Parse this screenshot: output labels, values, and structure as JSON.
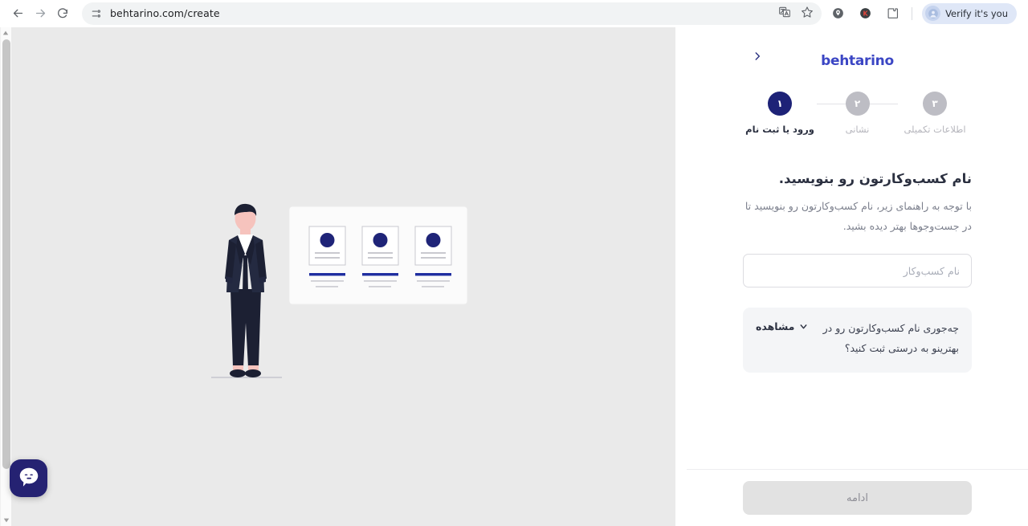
{
  "browser": {
    "back_icon": "arrow-left-icon",
    "forward_icon": "arrow-right-icon",
    "reload_icon": "reload-icon",
    "site_info_icon": "page-info-icon",
    "url": "behtarino.com/create",
    "translate_icon": "translate-icon",
    "bookmark_icon": "star-icon",
    "ext_lens_icon": "lens-extension-icon",
    "ext_k_icon": "k-extension-icon",
    "ext_puzzle_icon": "extensions-puzzle-icon",
    "profile": {
      "avatar_icon": "profile-avatar-icon",
      "label": "Verify it's you"
    }
  },
  "panel": {
    "brand": "behtarino",
    "next_icon": "chevron-right-icon",
    "stepper": [
      {
        "number": "۳",
        "label": "اطلاعات تکمیلی",
        "active": false
      },
      {
        "number": "۲",
        "label": "نشانی",
        "active": false
      },
      {
        "number": "۱",
        "label": "ورود یا ثبت نام",
        "active": true
      }
    ],
    "title": "نام کسب‌وکارتون رو بنویسید.",
    "subtitle": "با توجه به راهنمای زیر، نام کسب‌وکارتون رو بنویسید تا در جست‌وجوها بهتر دیده بشید.",
    "business_name_input": {
      "placeholder": "نام کسب‌وکار",
      "value": ""
    },
    "accordion": {
      "question": "چه‌جوری نام کسب‌وکارتون رو در بهترینو به درستی ثبت کنید؟",
      "toggle_label": "مشاهده",
      "chevron_icon": "chevron-down-icon"
    },
    "submit_label": "ادامه"
  },
  "canvas": {
    "illustration_name": "person-viewing-board-illustration",
    "chat_widget_icon": "chat-bubble-icon",
    "scrollbar": {
      "up_icon": "scroll-up-arrow-icon",
      "down_icon": "scroll-down-arrow-icon"
    }
  },
  "colors": {
    "brand": "#3b46c4",
    "accent_navy": "#1d2277",
    "canvas_bg": "#eaeaea",
    "muted": "#bdbdc4",
    "disabled_btn": "#e2e2e2"
  }
}
